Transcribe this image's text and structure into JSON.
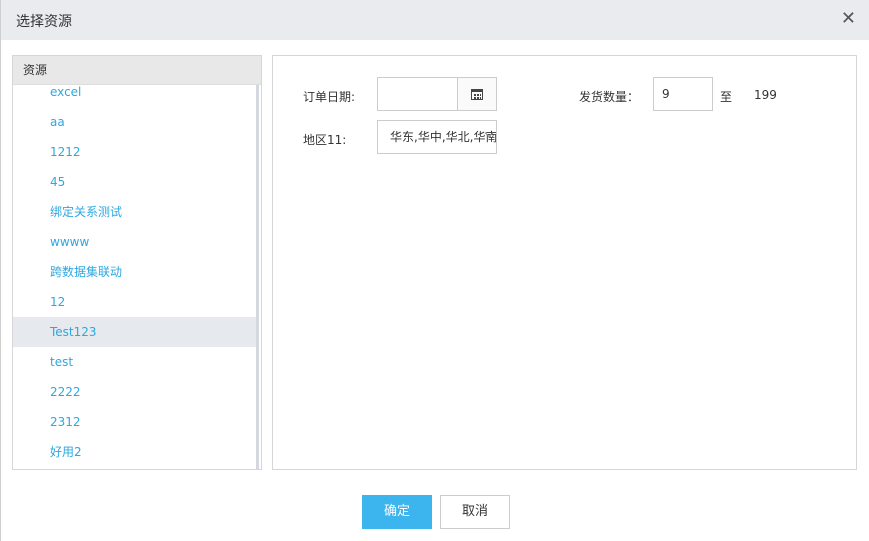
{
  "dialog": {
    "title": "选择资源",
    "close_icon": "close-icon"
  },
  "sidebar": {
    "header": "资源",
    "items": [
      {
        "label": "excel"
      },
      {
        "label": "aa"
      },
      {
        "label": "1212"
      },
      {
        "label": "45"
      },
      {
        "label": "绑定关系测试"
      },
      {
        "label": "wwww"
      },
      {
        "label": "跨数据集联动"
      },
      {
        "label": "12"
      },
      {
        "label": "Test123",
        "selected": true
      },
      {
        "label": "test"
      },
      {
        "label": "2222"
      },
      {
        "label": "2312"
      },
      {
        "label": "好用2"
      }
    ]
  },
  "form": {
    "order_date_label": "订单日期:",
    "order_date_value": "",
    "calendar_icon": "calendar-icon",
    "ship_qty_label": "发货数量：",
    "ship_qty_from": "9",
    "ship_qty_to_label": "至",
    "ship_qty_to": "199",
    "region_label": "地区11:",
    "region_value": "华东,华中,华北,华南"
  },
  "footer": {
    "ok_label": "确定",
    "cancel_label": "取消"
  },
  "colors": {
    "accent": "#3cb5ee",
    "link": "#2ea7e0",
    "titlebar": "#e9ebee"
  }
}
